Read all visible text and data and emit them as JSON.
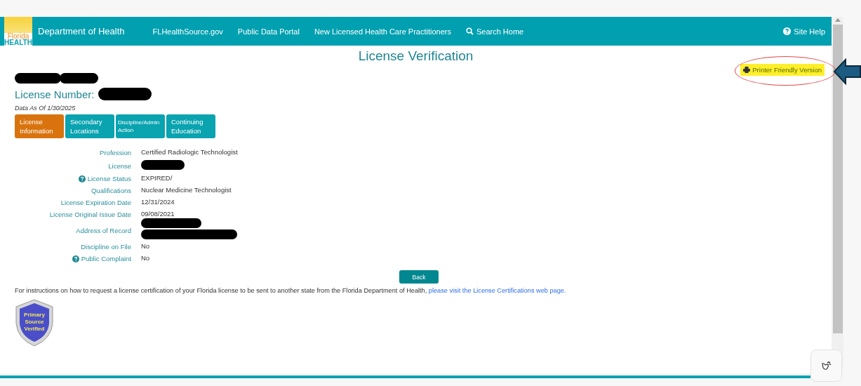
{
  "header": {
    "logo_text": [
      "Florida",
      "HEALTH"
    ],
    "title": "Department of Health",
    "nav": [
      "FLHealthSource.gov",
      "Public Data Portal",
      "New Licensed Health Care Practitioners"
    ],
    "search": "Search Home",
    "help": "Site Help"
  },
  "page_title": "License Verification",
  "printer_link": "Printer Friendly Version",
  "license_number_label": "License Number:",
  "data_as_of": "Data As Of 1/30/2025",
  "tabs": [
    {
      "label": "License Information",
      "selected": true
    },
    {
      "label": "Secondary Locations",
      "selected": false
    },
    {
      "label": "Discipline/Admin Action",
      "selected": false
    },
    {
      "label": "Continuing Education",
      "selected": false
    }
  ],
  "details": [
    {
      "label": "Profession",
      "help": false,
      "kind": "text",
      "value": "Certified Radiologic Technologist"
    },
    {
      "label": "License",
      "help": false,
      "kind": "redacted"
    },
    {
      "label": "License Status",
      "help": true,
      "kind": "text",
      "value": "EXPIRED/"
    },
    {
      "label": "Qualifications",
      "help": false,
      "kind": "text",
      "value": "Nuclear Medicine Technologist"
    },
    {
      "label": "License Expiration Date",
      "help": false,
      "kind": "text",
      "value": "12/31/2024"
    },
    {
      "label": "License Original Issue Date",
      "help": false,
      "kind": "text",
      "value": "09/08/2021"
    },
    {
      "label": "Address of Record",
      "help": false,
      "kind": "redacted_block"
    },
    {
      "label": "Discipline on File",
      "help": false,
      "kind": "text",
      "value": "No"
    },
    {
      "label": "Public Complaint",
      "help": true,
      "kind": "text",
      "value": "No"
    }
  ],
  "back_button": "Back",
  "instructions": {
    "text": "For instructions on how to request a license certification of your Florida license to be sent to another state from the Florida Department of Health,",
    "link": "please visit the License Certifications web page."
  },
  "badge": [
    "Primary",
    "Source",
    "Verified"
  ]
}
